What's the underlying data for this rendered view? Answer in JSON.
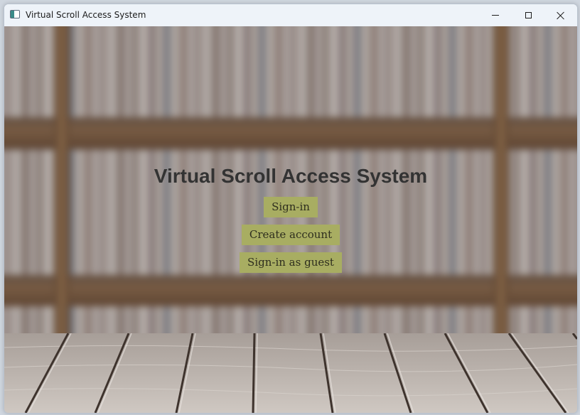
{
  "window": {
    "title": "Virtual Scroll Access System",
    "app_icon": "window-app-icon",
    "controls": {
      "minimize_icon": "minimize-icon",
      "maximize_icon": "maximize-icon",
      "close_icon": "close-icon"
    }
  },
  "main": {
    "heading": "Virtual Scroll Access System",
    "buttons": {
      "sign_in": "Sign-in",
      "create_account": "Create account",
      "guest": "Sign-in as guest"
    }
  },
  "colors": {
    "button_bg": "#a8ad62",
    "heading_text": "#333333",
    "titlebar_bg": "#eef3f9"
  }
}
